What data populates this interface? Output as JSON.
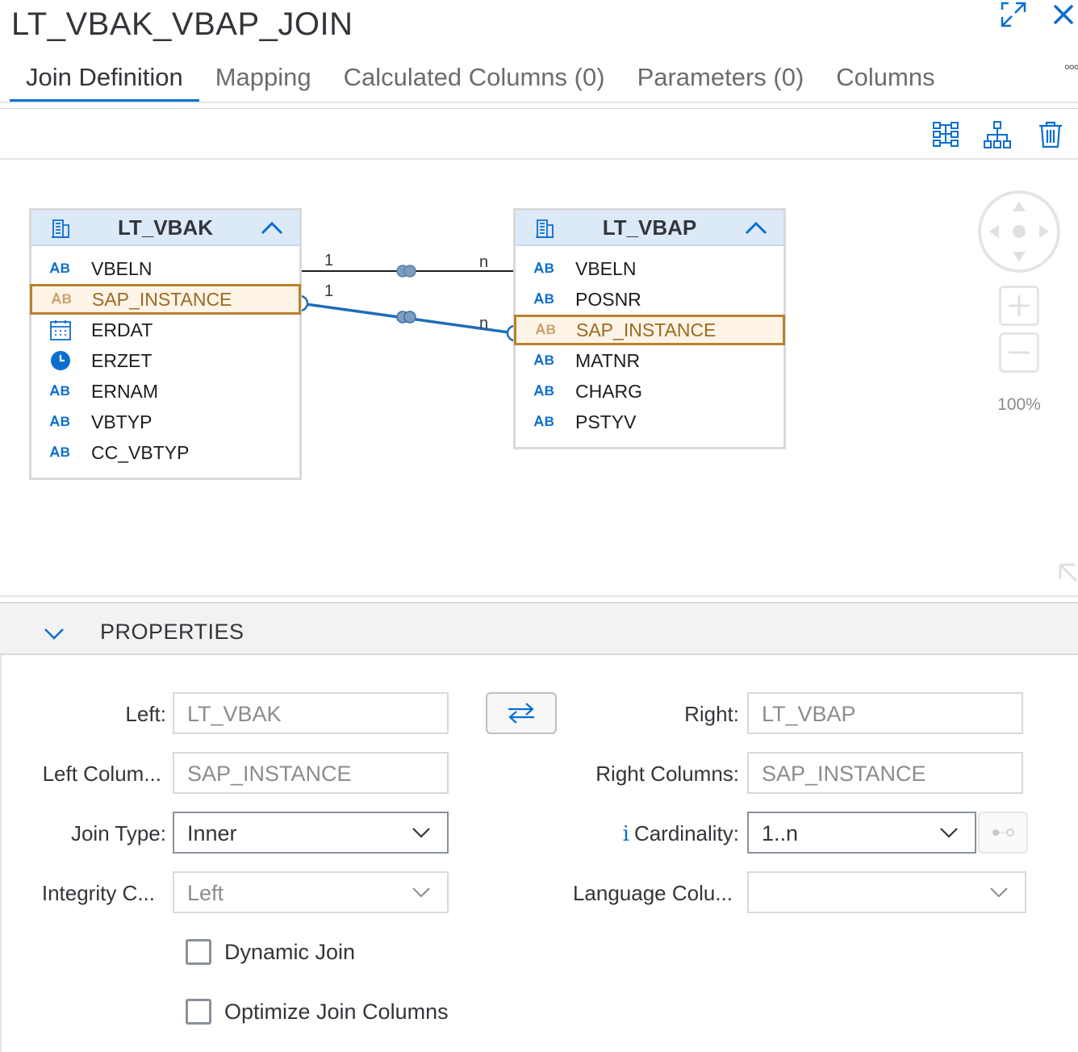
{
  "window": {
    "title": "LT_VBAK_VBAP_JOIN",
    "more_label": "◦◦◦"
  },
  "tabs": [
    {
      "label": "Join Definition",
      "active": true
    },
    {
      "label": "Mapping"
    },
    {
      "label": "Calculated Columns (0)"
    },
    {
      "label": "Parameters (0)"
    },
    {
      "label": "Columns"
    }
  ],
  "left_table": {
    "name": "LT_VBAK",
    "columns": [
      {
        "type": "AB",
        "name": "VBELN"
      },
      {
        "type": "AB",
        "name": "SAP_INSTANCE",
        "selected": true
      },
      {
        "type": "date",
        "name": "ERDAT"
      },
      {
        "type": "time",
        "name": "ERZET"
      },
      {
        "type": "AB",
        "name": "ERNAM"
      },
      {
        "type": "AB",
        "name": "VBTYP"
      },
      {
        "type": "AB",
        "name": "CC_VBTYP"
      }
    ]
  },
  "right_table": {
    "name": "LT_VBAP",
    "columns": [
      {
        "type": "AB",
        "name": "VBELN"
      },
      {
        "type": "AB",
        "name": "POSNR"
      },
      {
        "type": "AB",
        "name": "SAP_INSTANCE",
        "selected": true
      },
      {
        "type": "AB",
        "name": "MATNR"
      },
      {
        "type": "AB",
        "name": "CHARG"
      },
      {
        "type": "AB",
        "name": "PSTYV"
      }
    ]
  },
  "joins": [
    {
      "from": "VBELN",
      "to": "VBELN",
      "left_card": "1",
      "right_card": "n",
      "selected": false
    },
    {
      "from": "SAP_INSTANCE",
      "to": "SAP_INSTANCE",
      "left_card": "1",
      "right_card": "n",
      "selected": true
    }
  ],
  "canvas": {
    "zoom_label": "100%"
  },
  "colors": {
    "accent": "#0a6ed1",
    "selection": "#b9812b",
    "header_bg": "#dce9f7"
  },
  "properties": {
    "title": "PROPERTIES",
    "left_label": "Left:",
    "left_value": "LT_VBAK",
    "right_label": "Right:",
    "right_value": "LT_VBAP",
    "left_columns_label": "Left Colum...",
    "left_columns_value": "SAP_INSTANCE",
    "right_columns_label": "Right Columns:",
    "right_columns_value": "SAP_INSTANCE",
    "join_type_label": "Join Type:",
    "join_type_value": "Inner",
    "cardinality_info": "i",
    "cardinality_label": "Cardinality:",
    "cardinality_value": "1..n",
    "integrity_label": "Integrity C...",
    "integrity_value": "Left",
    "language_label": "Language Colu...",
    "language_value": "",
    "dynamic_join_label": "Dynamic Join",
    "dynamic_join_checked": false,
    "optimize_label": "Optimize Join Columns",
    "optimize_checked": false
  },
  "icons": {
    "maximize": "maximize-icon",
    "close": "close-icon",
    "auto_layout": "auto-layout-icon",
    "hierarchy": "hierarchy-icon",
    "delete": "delete-icon",
    "swap": "swap-icon",
    "collapse": "chevron-up-icon",
    "props_collapse": "chevron-down-icon"
  }
}
